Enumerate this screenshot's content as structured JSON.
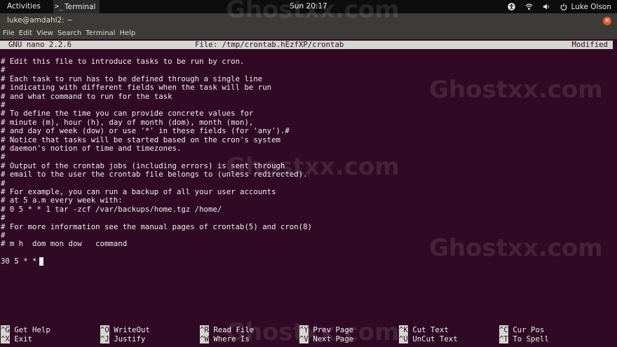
{
  "topbar": {
    "activities": "Activities",
    "app_name": "Terminal",
    "app_glyph": ">_",
    "clock": "Sun 20:17",
    "user": "Luke Olson",
    "icons": [
      "accessibility-icon",
      "network-icon",
      "sound-icon",
      "power-icon"
    ]
  },
  "window": {
    "title": "luke@amdahl2: ~"
  },
  "menu": [
    "File",
    "Edit",
    "View",
    "Search",
    "Terminal",
    "Help"
  ],
  "nano": {
    "version": "GNU nano 2.2.6",
    "file": "File: /tmp/crontab.hEzfXP/crontab",
    "status": "Modified"
  },
  "buffer": [
    "# Edit this file to introduce tasks to be run by cron.",
    "#",
    "# Each task to run has to be defined through a single line",
    "# indicating with different fields when the task will be run",
    "# and what command to run for the task",
    "#",
    "# To define the time you can provide concrete values for",
    "# minute (m), hour (h), day of month (dom), month (mon),",
    "# and day of week (dow) or use '*' in these fields (for 'any').#",
    "# Notice that tasks will be started based on the cron's system",
    "# daemon's notion of time and timezones.",
    "#",
    "# Output of the crontab jobs (including errors) is sent through",
    "# email to the user the crontab file belongs to (unless redirected).",
    "#",
    "# For example, you can run a backup of all your user accounts",
    "# at 5 a.m every week with:",
    "# 0 5 * * 1 tar -zcf /var/backups/home.tgz /home/",
    "#",
    "# For more information see the manual pages of crontab(5) and cron(8)",
    "#",
    "# m h  dom mon dow   command",
    "",
    "30 5 * * "
  ],
  "shortcuts": [
    [
      {
        "key": "^G",
        "label": "Get Help"
      },
      {
        "key": "^O",
        "label": "WriteOut"
      },
      {
        "key": "^R",
        "label": "Read File"
      },
      {
        "key": "^Y",
        "label": "Prev Page"
      },
      {
        "key": "^K",
        "label": "Cut Text"
      },
      {
        "key": "^C",
        "label": "Cur Pos"
      }
    ],
    [
      {
        "key": "^X",
        "label": "Exit"
      },
      {
        "key": "^J",
        "label": "Justify"
      },
      {
        "key": "^W",
        "label": "Where Is"
      },
      {
        "key": "^V",
        "label": "Next Page"
      },
      {
        "key": "^U",
        "label": "UnCut Text"
      },
      {
        "key": "^T",
        "label": "To Spell"
      }
    ]
  ],
  "watermark": "Ghostxx.com"
}
